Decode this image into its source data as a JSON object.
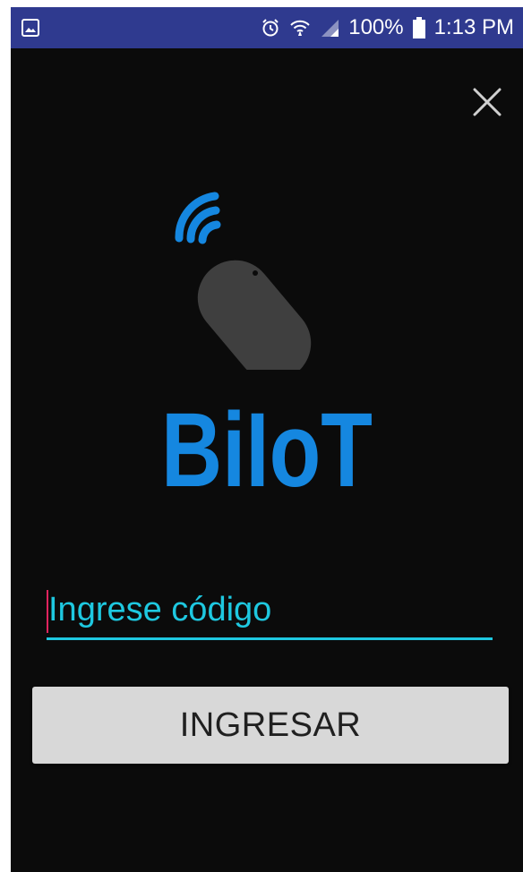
{
  "status_bar": {
    "left_icon": "gallery-notification-icon",
    "icons": [
      "alarm-icon",
      "wifi-icon",
      "cell-signal-icon",
      "battery-icon"
    ],
    "battery": "100%",
    "time": "1:13 PM",
    "background_color": "#2f3a8f"
  },
  "header": {
    "close_icon": "close-icon"
  },
  "logo": {
    "icon": "wireless-tag-logo-icon",
    "title": "BiIoT",
    "accent_color": "#1587e0"
  },
  "form": {
    "code_input": {
      "placeholder": "Ingrese código",
      "value": "",
      "accent_color": "#1ec8e0"
    },
    "submit_label": "INGRESAR"
  }
}
